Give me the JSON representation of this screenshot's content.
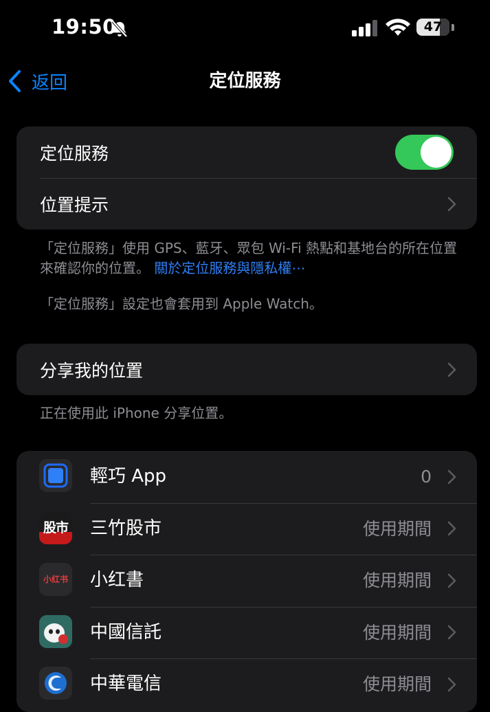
{
  "status_bar": {
    "time": "19:50",
    "battery": "47",
    "icons": [
      "bell-slash-icon",
      "cellular-signal-icon",
      "wifi-icon",
      "battery-icon"
    ]
  },
  "nav": {
    "back_label": "返回",
    "title": "定位服務"
  },
  "main_group": {
    "location_services_label": "定位服務",
    "location_services_enabled": true,
    "location_alerts_label": "位置提示"
  },
  "footer1": {
    "text": "「定位服務」使用 GPS、藍牙、眾包 Wi-Fi 熱點和基地台的所在位置來確認你的位置。",
    "link": "關於定位服務與隱私權⋯"
  },
  "footer2": "「定位服務」設定也會套用到 Apple Watch。",
  "share_group": {
    "label": "分享我的位置"
  },
  "footer3": "正在使用此 iPhone 分享位置。",
  "apps": [
    {
      "name": "輕巧 App",
      "value": "0",
      "icon": "qingqiao-app-icon"
    },
    {
      "name": "三竹股市",
      "value": "使用期間",
      "icon": "sanzhu-stock-icon",
      "icon_text": "股市"
    },
    {
      "name": "小红書",
      "value": "使用期間",
      "icon": "xiaohongshu-icon",
      "icon_text": "小红书"
    },
    {
      "name": "中國信託",
      "value": "使用期間",
      "icon": "ctbc-mascot-icon"
    },
    {
      "name": "中華電信",
      "value": "使用期間",
      "icon": "chunghwa-telecom-icon"
    }
  ],
  "colors": {
    "accent": "#0a84ff",
    "toggle_on": "#34c759",
    "group_bg": "#1c1c1e",
    "secondary_text": "#8d8d93"
  }
}
